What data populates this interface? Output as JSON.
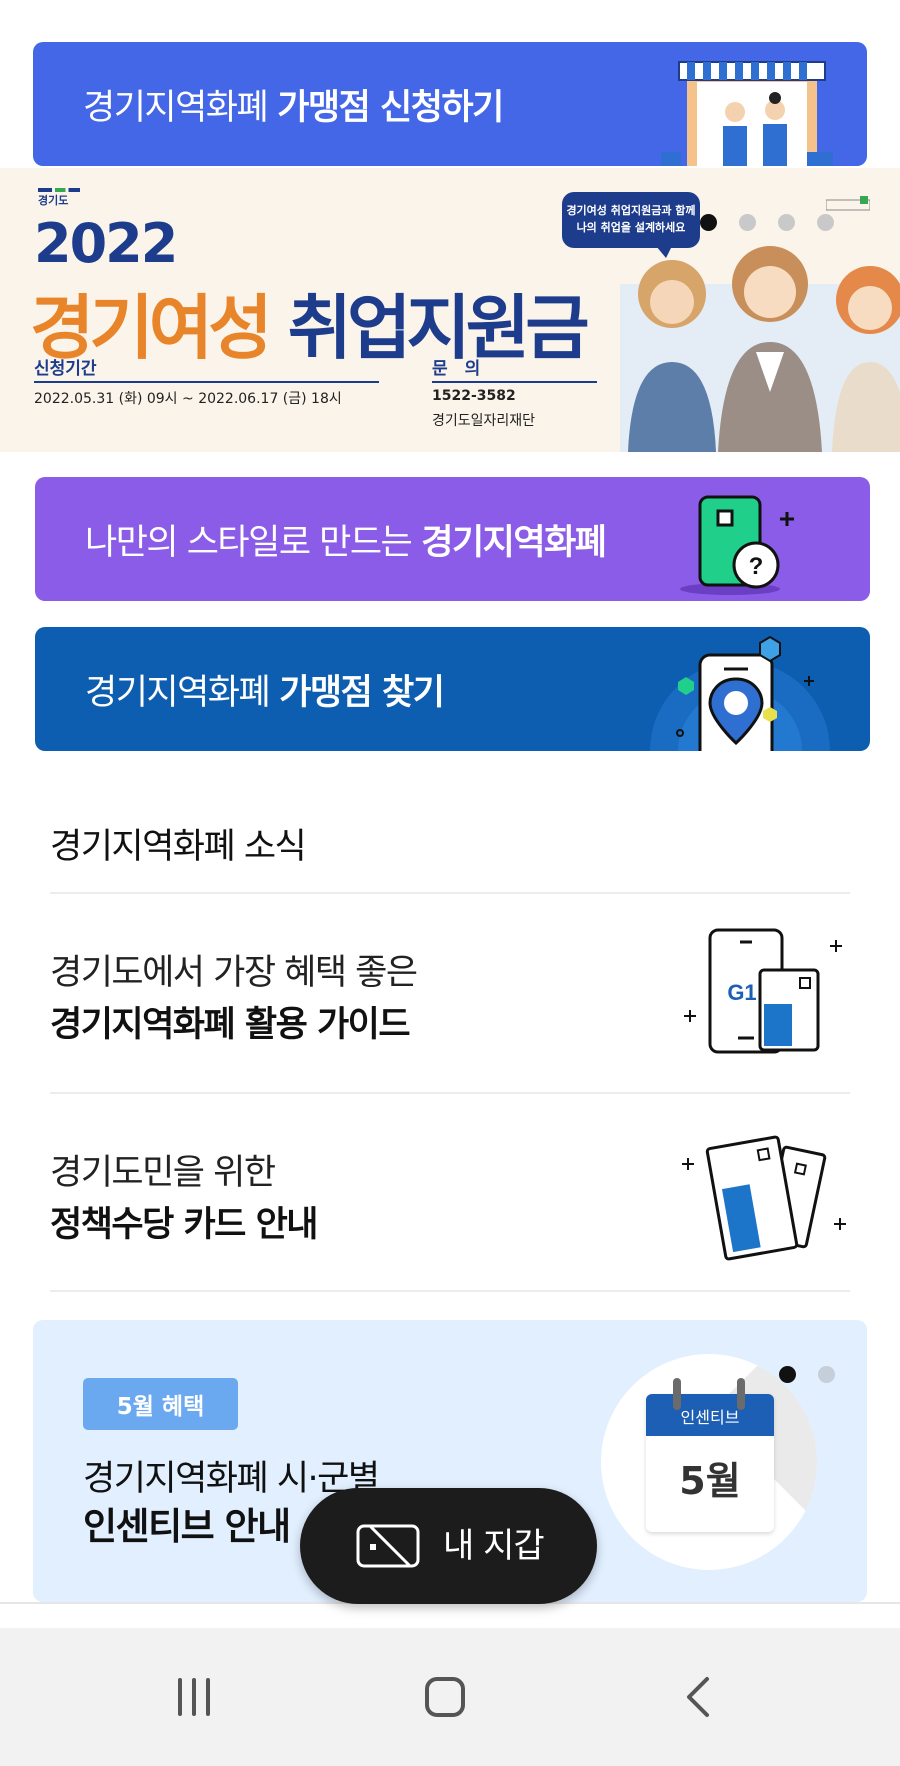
{
  "banners": {
    "merchant_apply": {
      "text_regular": "경기지역화폐",
      "text_bold": "가맹점 신청하기",
      "bg": "#4467e8"
    },
    "my_style": {
      "text_regular": "나만의 스타일로 만드는",
      "text_bold": "경기지역화폐",
      "bg": "#8b5ce8"
    },
    "merchant_find": {
      "text_regular": "경기지역화폐",
      "text_bold": "가맹점 찾기",
      "bg": "#0d5eb1"
    }
  },
  "promo": {
    "gov_label": "경기도",
    "year": "2022",
    "headline_orange": "경기여성",
    "headline_navy": "취업지원금",
    "period_label": "신청기간",
    "period_value": "2022.05.31 (화) 09시 ~ 2022.06.17 (금) 18시",
    "contact_label": "문　의",
    "contact_phone": "1522-3582",
    "contact_org": "경기도일자리재단",
    "bubble_line1": "경기여성 취업지원금과 함께",
    "bubble_line2": "나의 취업을 설계하세요",
    "active_slide": 1,
    "slide_count": 4
  },
  "news": {
    "title": "경기지역화폐 소식",
    "items": [
      {
        "line1": "경기도에서 가장 혜택 좋은",
        "line2": "경기지역화폐 활용 가이드"
      },
      {
        "line1": "경기도민을 위한",
        "line2": "정책수당 카드 안내"
      }
    ]
  },
  "incentive": {
    "badge": "5월 혜택",
    "line1": "경기지역화폐 시·군별",
    "line2": "인센티브 안내",
    "calendar_header": "인센티브",
    "calendar_month": "5월",
    "active_slide": 1,
    "slide_count": 2
  },
  "wallet_button": {
    "label": "내 지갑"
  },
  "colors": {
    "accent_blue": "#4467e8",
    "purple": "#8b5ce8",
    "navy": "#0d5eb1",
    "promo_orange": "#e8842a",
    "promo_navy": "#1d3d8c"
  }
}
